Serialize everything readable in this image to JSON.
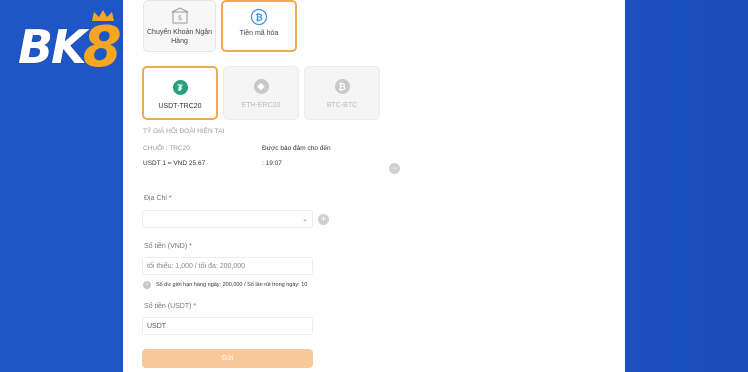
{
  "brand": {
    "logo_text_bk": "BK",
    "logo_text_8": "8"
  },
  "payment_methods": [
    {
      "label": "Chuyển Khoản Ngân Hàng",
      "icon": "bank-transfer-icon",
      "active": false
    },
    {
      "label": "Tiền mã hóa",
      "icon": "bitcoin-icon",
      "active": true
    }
  ],
  "coins": [
    {
      "label": "USDT-TRC20",
      "icon": "tether-icon",
      "color": "#26a17b",
      "active": true
    },
    {
      "label": "ETH-ERC20",
      "icon": "ethereum-icon",
      "color": "#c9c9c9",
      "active": false
    },
    {
      "label": "BTC-BTC",
      "icon": "bitcoin-icon",
      "color": "#c9c9c9",
      "active": false
    }
  ],
  "exchange": {
    "heading": "TỶ GIÁ HỐI ĐOÁI HIỆN TẠI",
    "chain_label": "CHUỖI : TRC20",
    "guarantee_label": "Được bảo đảm cho đến",
    "rate": "USDT 1 = VND 25.67",
    "time": ": 19:07"
  },
  "address": {
    "label": "Địa Chỉ",
    "required": "*",
    "value": ""
  },
  "amount_vnd": {
    "label": "Số tiền (VND)",
    "required": "*",
    "placeholder": "tối thiểu: 1,000 / tối đa: 200,000",
    "limit_note": "Số dư giới hạn hàng ngày: 200,000 / Số lần rút trong ngày: 10"
  },
  "amount_usdt": {
    "label": "Số tiền (USDT)",
    "required": "*",
    "value": "USDT"
  },
  "submit_label": "Gửi",
  "colors": {
    "accent": "#f0a955",
    "background": "#1f56c6"
  }
}
